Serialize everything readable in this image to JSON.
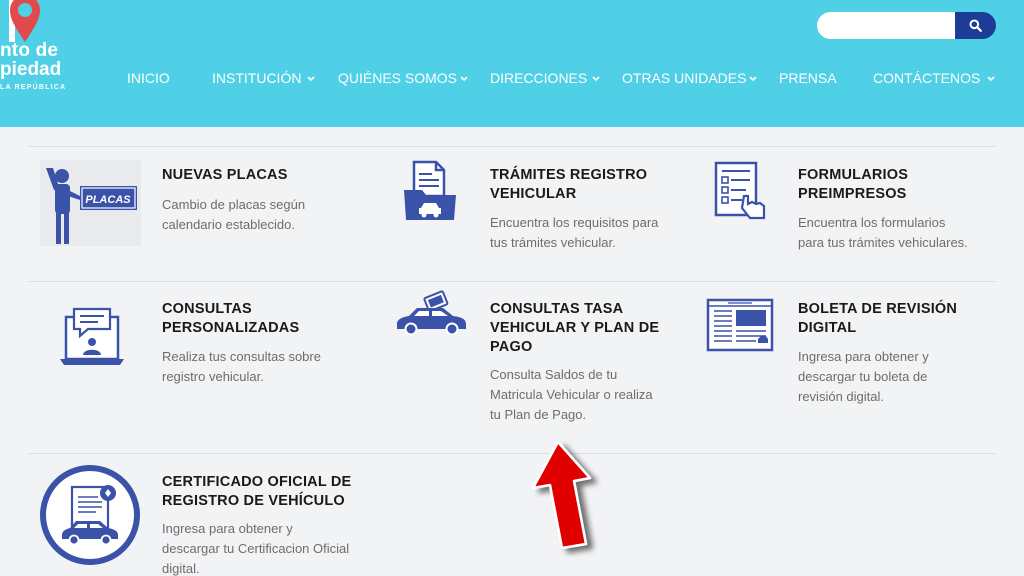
{
  "header": {
    "logo": {
      "line1": "nto de",
      "line2": "piedad",
      "line3": "LA REPÚBLICA"
    },
    "search": {
      "placeholder": "",
      "value": "",
      "button_icon": "search-icon"
    },
    "nav": [
      {
        "label": "INICIO",
        "has_dropdown": false
      },
      {
        "label": "INSTITUCIÓN",
        "has_dropdown": true
      },
      {
        "label": "QUIÉNES SOMOS",
        "has_dropdown": true
      },
      {
        "label": "DIRECCIONES",
        "has_dropdown": true
      },
      {
        "label": "OTRAS UNIDADES",
        "has_dropdown": true
      },
      {
        "label": "PRENSA",
        "has_dropdown": false
      },
      {
        "label": "CONTÁCTENOS",
        "has_dropdown": true
      }
    ]
  },
  "cards": [
    {
      "icon": "license-plate-person-icon",
      "icon_text": "PLACAS",
      "title": [
        "NUEVAS PLACAS"
      ],
      "desc": [
        "Cambio de placas según",
        "calendario establecido."
      ]
    },
    {
      "icon": "vehicle-folder-icon",
      "title": [
        "TRÁMITES REGISTRO",
        "VEHICULAR"
      ],
      "desc": [
        "Encuentra los requisitos para",
        "tus trámites vehicular."
      ]
    },
    {
      "icon": "form-hand-icon",
      "title": [
        "FORMULARIOS",
        "PREIMPRESOS"
      ],
      "desc": [
        "Encuentra los formularios",
        "para tus trámites vehiculares."
      ]
    },
    {
      "icon": "laptop-chat-icon",
      "title": [
        "CONSULTAS",
        "PERSONALIZADAS"
      ],
      "desc": [
        "Realiza tus consultas sobre",
        "registro vehicular."
      ]
    },
    {
      "icon": "car-payment-icon",
      "title": [
        "CONSULTAS TASA",
        "VEHICULAR Y PLAN DE",
        "PAGO"
      ],
      "desc": [
        "Consulta Saldos de tu",
        "Matricula Vehicular o realiza",
        "tu Plan de Pago."
      ]
    },
    {
      "icon": "newspaper-icon",
      "title": [
        "BOLETA DE REVISIÓN",
        "DIGITAL"
      ],
      "desc": [
        "Ingresa para obtener y",
        "descargar tu boleta de",
        "revisión digital."
      ]
    },
    {
      "icon": "certificate-car-icon",
      "title": [
        "CERTIFICADO OFICIAL DE",
        "REGISTRO DE VEHÍCULO"
      ],
      "desc": [
        "Ingresa para obtener y",
        "descargar tu Certificacion Oficial",
        "digital."
      ]
    }
  ],
  "colors": {
    "header_bg": "#4fd0e6",
    "accent_blue": "#3a52a8",
    "search_button": "#1d3c97",
    "logo_pin": "#e14a4a",
    "annotation_arrow": "#e00000"
  }
}
